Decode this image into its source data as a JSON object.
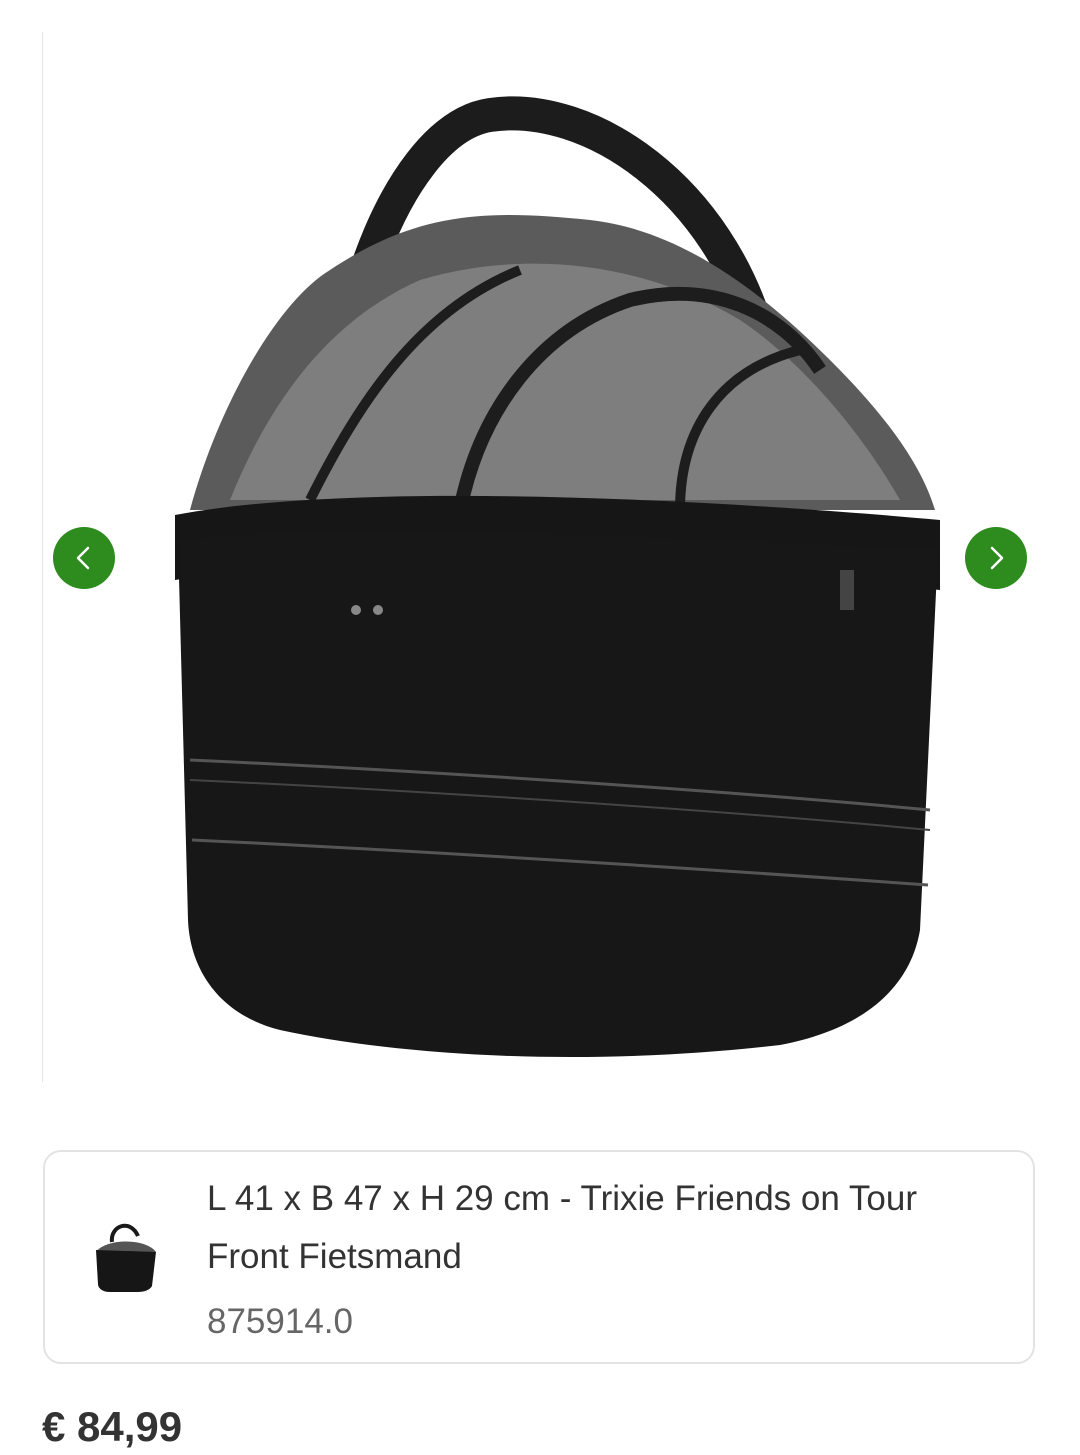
{
  "gallery": {
    "image_icon": "black-pet-bike-basket-product-photo",
    "prev_icon": "chevron-left-icon",
    "next_icon": "chevron-right-icon",
    "accent_color": "#2e8b1e"
  },
  "variant": {
    "title": "L 41 x B 47 x H 29 cm - Trixie Friends on Tour Front Fietsmand",
    "sku": "875914.0",
    "thumb_icon": "pet-basket-thumbnail"
  },
  "price": "€ 84,99"
}
